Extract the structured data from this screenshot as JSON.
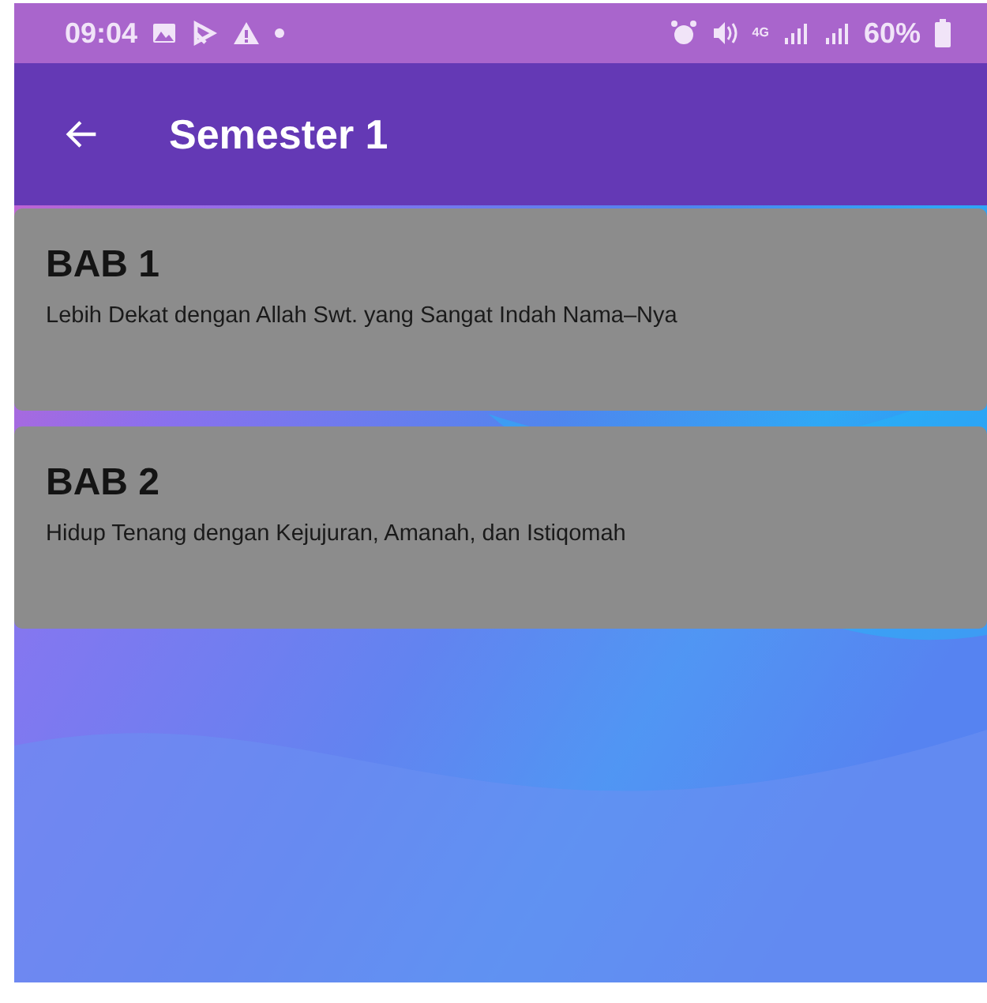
{
  "status_bar": {
    "time": "09:04",
    "network": "4G",
    "battery": "60%"
  },
  "app_bar": {
    "title": "Semester 1"
  },
  "chapters": [
    {
      "title": "BAB 1",
      "subtitle": "Lebih Dekat dengan Allah Swt. yang Sangat Indah Nama–Nya"
    },
    {
      "title": "BAB 2",
      "subtitle": "Hidup Tenang dengan Kejujuran, Amanah, dan Istiqomah"
    }
  ]
}
